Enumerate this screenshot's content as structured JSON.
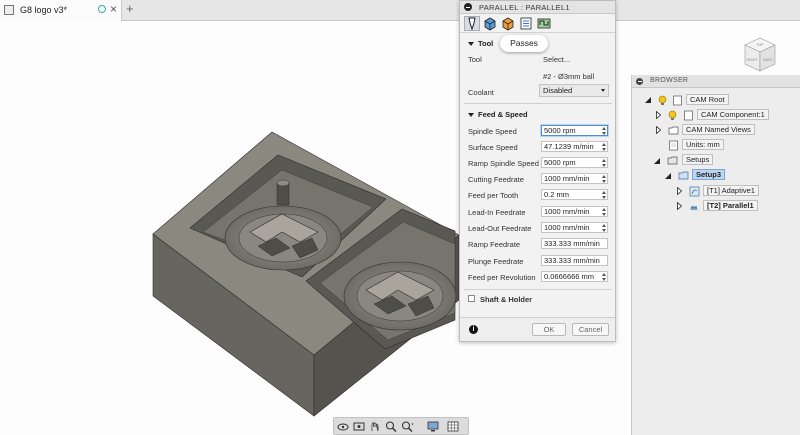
{
  "document": {
    "title": "G8 logo v3*"
  },
  "dialog": {
    "title": "PARALLEL : PARALLEL1",
    "tooltip": "Passes",
    "tool_section": "Tool",
    "tool_label": "Tool",
    "tool_select": "Select...",
    "tool_value": "#2 - Ø3mm ball",
    "coolant_label": "Coolant",
    "coolant_value": "Disabled",
    "feed_section": "Feed & Speed",
    "fields": [
      {
        "label": "Spindle Speed",
        "value": "5000 rpm"
      },
      {
        "label": "Surface Speed",
        "value": "47.1239 m/min"
      },
      {
        "label": "Ramp Spindle Speed",
        "value": "5000 rpm"
      },
      {
        "label": "Cutting Feedrate",
        "value": "1000 mm/min"
      },
      {
        "label": "Feed per Tooth",
        "value": "0.2 mm"
      },
      {
        "label": "Lead-In Feedrate",
        "value": "1000 mm/min"
      },
      {
        "label": "Lead-Out Feedrate",
        "value": "1000 mm/min"
      },
      {
        "label": "Ramp Feedrate",
        "value": "333.333 mm/min"
      },
      {
        "label": "Plunge Feedrate",
        "value": "333.333 mm/min"
      },
      {
        "label": "Feed per Revolution",
        "value": "0.0666666 mm"
      }
    ],
    "shaft_section": "Shaft & Holder",
    "ok_label": "OK",
    "cancel_label": "Cancel",
    "info_label": "i"
  },
  "browser": {
    "title": "BROWSER",
    "nodes": {
      "cam_root": "CAM Root",
      "cam_component": "CAM Component:1",
      "cam_named_views": "CAM Named Views",
      "units": "Units: mm",
      "setups": "Setups",
      "setup3": "Setup3",
      "adaptive": "[T1] Adaptive1",
      "parallel": "[T2] Parallel1"
    }
  },
  "viewcube": {
    "faces": [
      "RIGHT",
      "BACK",
      "TOP"
    ]
  },
  "colors": {
    "accent": "#4d90d6",
    "selection": "#bcd6f2",
    "model": "#7d7a72"
  }
}
